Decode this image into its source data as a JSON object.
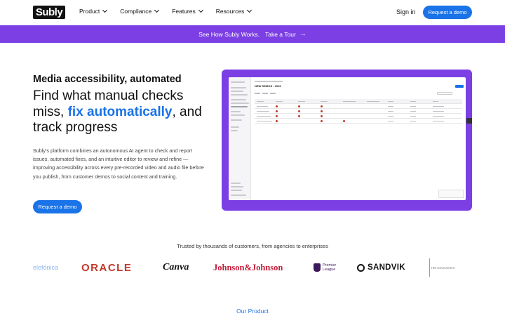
{
  "nav": {
    "logo": "Subly",
    "items": [
      {
        "label": "Product"
      },
      {
        "label": "Compliance"
      },
      {
        "label": "Features"
      },
      {
        "label": "Resources"
      }
    ],
    "signin": "Sign in",
    "cta": "Request a demo"
  },
  "banner": {
    "text": "See How Subly Works.",
    "link": "Take a Tour",
    "arrow": "→"
  },
  "hero": {
    "kicker": "Media accessibility, automated",
    "headline_pre": "Find what manual checks miss, ",
    "headline_accent": "fix automatically",
    "headline_post": ", and track progress",
    "description": "Subly's platform combines an autonomous AI agent to check and report issues, automated fixes, and an intuitive editor to review and refine — improving accessibility across every pre-recorded video and audio file before you publish, from customer demos to social content and training.",
    "cta": "Request a demo"
  },
  "app_preview": {
    "title": "NEW DEMOS - 2025"
  },
  "trusted": {
    "text": "Trusted by thousands of customers, from agencies to enterprises",
    "logos": [
      {
        "name": "telefonica",
        "text": "elefónica"
      },
      {
        "name": "oracle",
        "text": "ORACLE"
      },
      {
        "name": "canva",
        "text": "Canva"
      },
      {
        "name": "johnson-johnson",
        "text": "Johnson&Johnson"
      },
      {
        "name": "premier-league",
        "text_1": "Premier",
        "text_2": "League"
      },
      {
        "name": "sandvik",
        "text": "SANDVIK"
      },
      {
        "name": "hm-government",
        "text": "HM Government"
      }
    ]
  },
  "our_product": "Our Product",
  "colors": {
    "brand_blue": "#1a73e8",
    "banner_purple": "#7b3fe4",
    "oracle_red": "#c0392b",
    "jj_red": "#c41e3a"
  }
}
